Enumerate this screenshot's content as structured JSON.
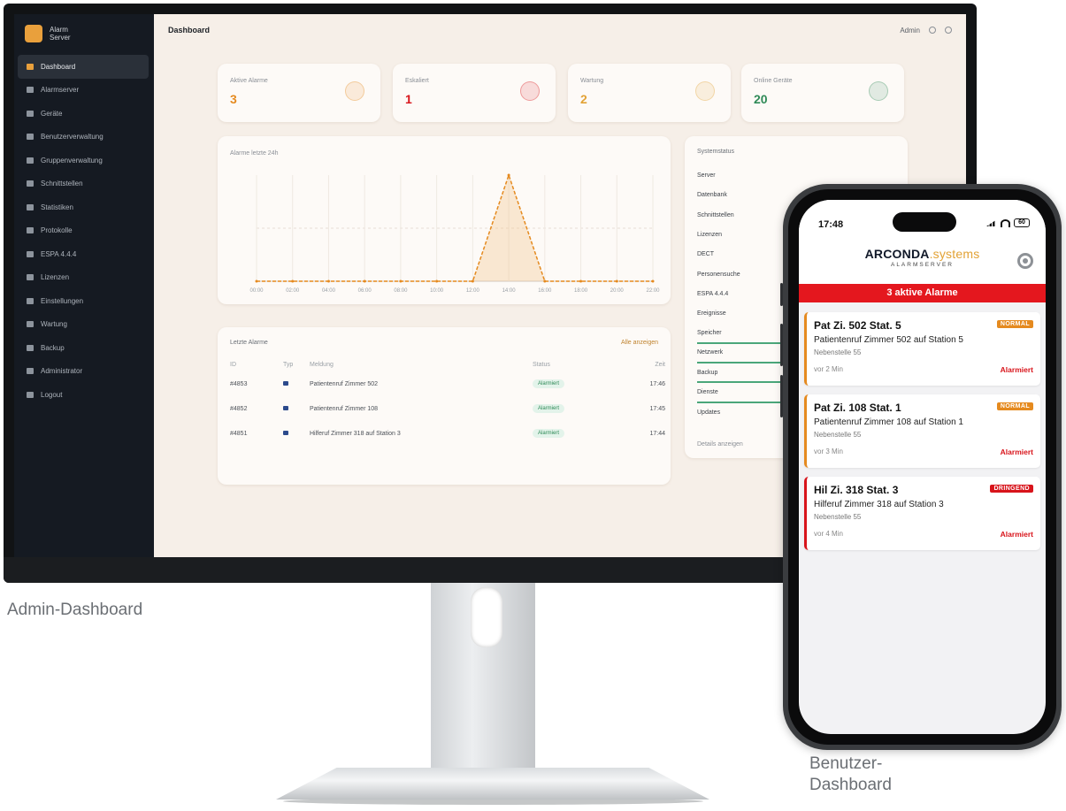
{
  "captions": {
    "admin": "Admin-Dashboard",
    "user": "Benutzer-\nDashboard"
  },
  "admin": {
    "brand": {
      "line1": "Alarm",
      "line2": "Server"
    },
    "nav": [
      {
        "label": "Dashboard",
        "active": true
      },
      {
        "label": "Alarmserver",
        "active": false
      },
      {
        "label": "Geräte",
        "active": false
      },
      {
        "label": "Benutzerverwaltung",
        "active": false
      },
      {
        "label": "Gruppenverwaltung",
        "active": false
      },
      {
        "label": "Schnittstellen",
        "active": false
      },
      {
        "label": "Statistiken",
        "active": false
      },
      {
        "label": "Protokolle",
        "active": false
      },
      {
        "label": "ESPA 4.4.4",
        "active": false
      },
      {
        "label": "Lizenzen",
        "active": false
      },
      {
        "label": "Einstellungen",
        "active": false
      },
      {
        "label": "Wartung",
        "active": false
      },
      {
        "label": "Backup",
        "active": false
      },
      {
        "label": "Administrator",
        "active": false
      },
      {
        "label": "Logout",
        "active": false
      }
    ],
    "header": {
      "title": "Dashboard",
      "user": "Admin"
    },
    "stats": [
      {
        "label": "Aktive Alarme",
        "value": "3",
        "color": "#e58a1f"
      },
      {
        "label": "Eskaliert",
        "value": "1",
        "color": "#d8141b"
      },
      {
        "label": "Wartung",
        "value": "2",
        "color": "#e2a235"
      },
      {
        "label": "Online Geräte",
        "value": "20",
        "color": "#2f8a57"
      }
    ],
    "chart": {
      "title": "Alarme letzte 24h"
    },
    "chart_data": {
      "type": "line",
      "x": [
        "00:00",
        "02:00",
        "04:00",
        "06:00",
        "08:00",
        "10:00",
        "12:00",
        "14:00",
        "16:00",
        "18:00",
        "20:00",
        "22:00"
      ],
      "series": [
        {
          "values": [
            0,
            0,
            0,
            0,
            0,
            0,
            0,
            1,
            0,
            0,
            0,
            0
          ]
        }
      ],
      "ylim": [
        0,
        1
      ]
    },
    "table": {
      "title": "Letzte Alarme",
      "link": "Alle anzeigen",
      "headers": [
        "ID",
        "Typ",
        "Meldung",
        "Status",
        "Zeit"
      ],
      "rows": [
        {
          "id": "#4853",
          "msg": "Patientenruf Zimmer 502",
          "status": "Alarmiert",
          "time": "17:46"
        },
        {
          "id": "#4852",
          "msg": "Patientenruf Zimmer 108",
          "status": "Alarmiert",
          "time": "17:45"
        },
        {
          "id": "#4851",
          "msg": "Hilferuf Zimmer 318 auf Station 3",
          "status": "Alarmiert",
          "time": "17:44"
        }
      ]
    },
    "status": {
      "title": "Systemstatus",
      "items": [
        "Server",
        "Datenbank",
        "Schnittstellen",
        "Lizenzen",
        "DECT",
        "Personensuche",
        "ESPA 4.4.4",
        "Ereignisse",
        "Speicher",
        "Netzwerk",
        "Backup",
        "Dienste",
        "Updates"
      ],
      "more": "Details anzeigen"
    }
  },
  "phone": {
    "time": "17:48",
    "battery": "60",
    "app_name": "ARCONDA",
    "app_name_suffix": ".systems",
    "app_subtitle": "ALARMSERVER",
    "banner": "3 aktive  Alarme",
    "alarms": [
      {
        "title": "Pat Zi. 502 Stat. 5",
        "badge": "NORMAL",
        "desc": "Patientenruf Zimmer 502 auf Station 5",
        "ext": "Nebenstelle 55",
        "age": "vor 2 Min",
        "state": "Alarmiert",
        "urgent": false
      },
      {
        "title": "Pat Zi. 108 Stat. 1",
        "badge": "NORMAL",
        "desc": "Patientenruf Zimmer 108 auf Station 1",
        "ext": "Nebenstelle 55",
        "age": "vor 3 Min",
        "state": "Alarmiert",
        "urgent": false
      },
      {
        "title": "Hil Zi. 318 Stat. 3",
        "badge": "DRINGEND",
        "desc": "Hilferuf Zimmer 318 auf Station 3",
        "ext": "Nebenstelle 55",
        "age": "vor 4 Min",
        "state": "Alarmiert",
        "urgent": true
      }
    ]
  }
}
